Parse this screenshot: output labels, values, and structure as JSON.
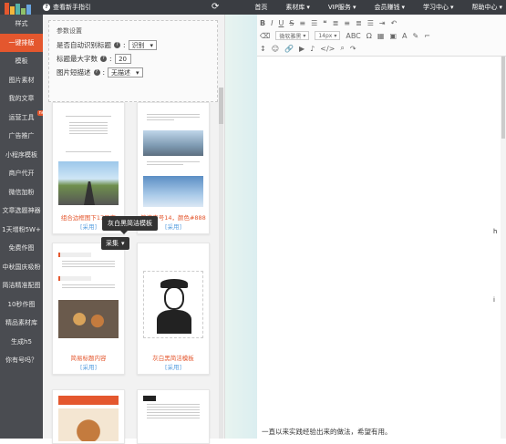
{
  "header": {
    "guide_label": "查看新手指引",
    "nav": [
      {
        "label": "首页",
        "caret": false
      },
      {
        "label": "素材库",
        "caret": true
      },
      {
        "label": "VIP服务",
        "caret": true
      },
      {
        "label": "会员赚钱",
        "caret": true
      },
      {
        "label": "学习中心",
        "caret": true
      },
      {
        "label": "帮助中心",
        "caret": true
      }
    ]
  },
  "sidebar": {
    "items": [
      {
        "label": "样式",
        "active": false
      },
      {
        "label": "一键排版",
        "active": true
      },
      {
        "label": "模板",
        "active": false
      },
      {
        "label": "图片素材",
        "active": false
      },
      {
        "label": "我的文章",
        "active": false
      },
      {
        "label": "运营工具",
        "active": false,
        "badge": "new"
      },
      {
        "label": "广告推广",
        "active": false
      },
      {
        "label": "小程序模板",
        "active": false
      },
      {
        "label": "商户代开",
        "active": false
      },
      {
        "label": "微信加粉",
        "active": false
      },
      {
        "label": "文章选题神器",
        "active": false
      },
      {
        "label": "1天增粉5W+",
        "active": false
      },
      {
        "label": "免费作图",
        "active": false
      },
      {
        "label": "中秋国庆吸粉",
        "active": false
      },
      {
        "label": "简洁精准配图",
        "active": false
      },
      {
        "label": "10秒作图",
        "active": false
      },
      {
        "label": "精品素材库",
        "active": false
      },
      {
        "label": "生成h5",
        "active": false
      },
      {
        "label": "你有号吗？",
        "active": false
      }
    ]
  },
  "settings": {
    "title": "参数设置",
    "auto_detect_label": "是否自动识别标题",
    "auto_detect_value": "识别",
    "max_chars_label": "标题最大字数",
    "max_chars_value": "20",
    "image_desc_label": "图片短描述",
    "image_desc_value": "无描述"
  },
  "templates": [
    {
      "caption": "组合边框图下17号字",
      "collect": "[采用]"
    },
    {
      "caption": "简洁字号14，颜色#888",
      "collect": "[采用]"
    },
    {
      "caption": "简易标题内容",
      "collect": "[采用]"
    },
    {
      "caption": "灰白黑简洁模板",
      "collect": "[采用]"
    }
  ],
  "tooltip": "灰白黑简洁模板",
  "collect_button": "采集",
  "editor": {
    "font_family": "微软雅黑",
    "font_size": "14px",
    "body_text": "一直以来实践经验出来的做法，希望有用。",
    "edge_chars": [
      "h",
      "i"
    ]
  },
  "colors": {
    "topbar": "#3a3d42",
    "sidebar": "#4a4c51",
    "accent": "#e4572e",
    "link": "#5aa0e0"
  }
}
